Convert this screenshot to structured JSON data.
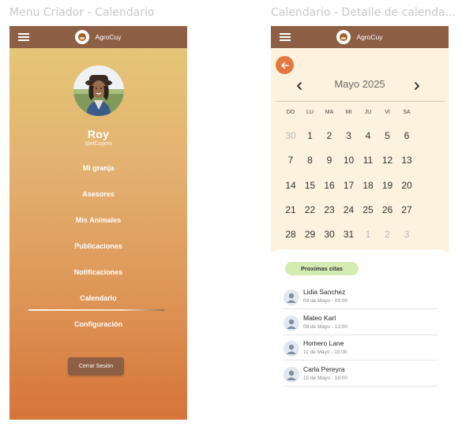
{
  "frames": {
    "left_title": "Menu Criador - Calendario",
    "right_title": "Calendario - Detalle de calenda..."
  },
  "app": {
    "name": "AgroCuy"
  },
  "profile": {
    "name": "Roy",
    "handle": "@elCuyero"
  },
  "menu": {
    "items": [
      "Mi granja",
      "Asesores",
      "Mis Animales",
      "Publicaciones",
      "Notificaciones",
      "Calendario",
      "Configuración"
    ],
    "active": "Calendario",
    "logout_label": "Cerrar Sesión"
  },
  "calendar": {
    "month_label": "Mayo 2025",
    "weekdays": [
      "DO",
      "LU",
      "MA",
      "MI",
      "JU",
      "VI",
      "SA"
    ],
    "weeks": [
      [
        {
          "d": "30",
          "m": true
        },
        {
          "d": "1"
        },
        {
          "d": "2"
        },
        {
          "d": "3"
        },
        {
          "d": "4"
        },
        {
          "d": "5"
        },
        {
          "d": "6"
        }
      ],
      [
        {
          "d": "7"
        },
        {
          "d": "8"
        },
        {
          "d": "9"
        },
        {
          "d": "10"
        },
        {
          "d": "11"
        },
        {
          "d": "12"
        },
        {
          "d": "13"
        }
      ],
      [
        {
          "d": "14"
        },
        {
          "d": "15"
        },
        {
          "d": "16"
        },
        {
          "d": "17"
        },
        {
          "d": "18"
        },
        {
          "d": "19"
        },
        {
          "d": "20"
        }
      ],
      [
        {
          "d": "21"
        },
        {
          "d": "22"
        },
        {
          "d": "23"
        },
        {
          "d": "24"
        },
        {
          "d": "25"
        },
        {
          "d": "26"
        },
        {
          "d": "27"
        }
      ],
      [
        {
          "d": "28"
        },
        {
          "d": "29"
        },
        {
          "d": "30"
        },
        {
          "d": "31"
        },
        {
          "d": "1",
          "m": true
        },
        {
          "d": "2",
          "m": true
        },
        {
          "d": "3",
          "m": true
        }
      ]
    ]
  },
  "appointments": {
    "title": "Proximas citas",
    "items": [
      {
        "name": "Lidia Sanchez",
        "date": "03 de Mayo - 09:00"
      },
      {
        "name": "Mateo Karl",
        "date": "09 de Mayo - 13:00"
      },
      {
        "name": "Homero Lane",
        "date": "11 de Mayo - 15:00"
      },
      {
        "name": "Carla Pereyra",
        "date": "15 de Mayo - 18:00"
      }
    ]
  },
  "colors": {
    "appbar": "#8d5f45",
    "gradient_top": "#e5c978",
    "gradient_bottom": "#d6743a",
    "accent_orange": "#e2783f",
    "calendar_bg": "#fcf2dd",
    "pill_green": "#d4ecb1"
  },
  "icons": [
    "menu-icon",
    "app-logo",
    "back-arrow-icon",
    "chevron-left-icon",
    "chevron-right-icon",
    "user-icon"
  ]
}
